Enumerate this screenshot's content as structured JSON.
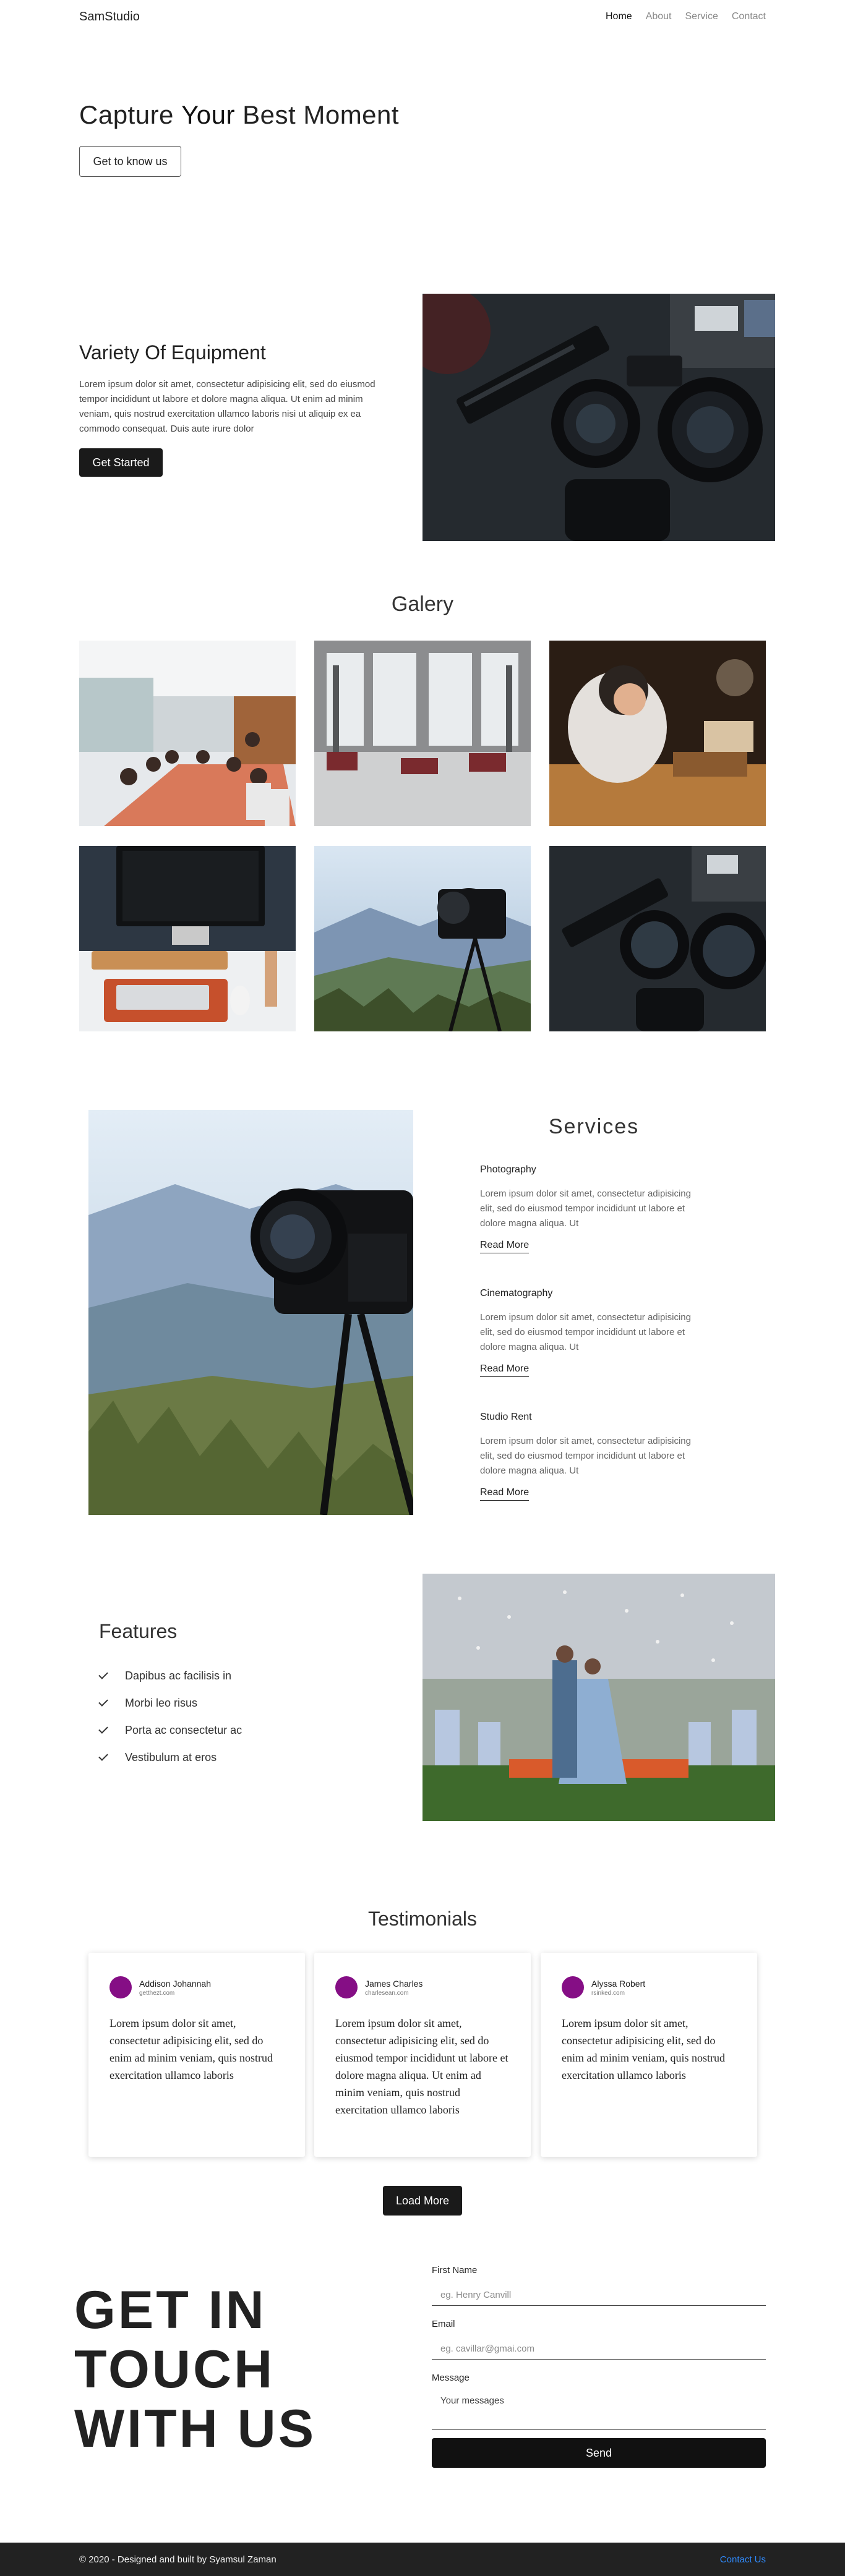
{
  "nav": {
    "brand": "SamStudio",
    "links": [
      {
        "label": "Home",
        "active": true
      },
      {
        "label": "About",
        "active": false
      },
      {
        "label": "Service",
        "active": false
      },
      {
        "label": "Contact",
        "active": false
      }
    ]
  },
  "hero": {
    "title_before": "Capture ",
    "title_bold": "Your",
    "title_after": " Best Moment",
    "button": "Get to know us"
  },
  "equipment": {
    "title": "Variety Of Equipment",
    "text": "Lorem ipsum dolor sit amet, consectetur adipisicing elit, sed do eiusmod tempor incididunt ut labore et dolore magna aliqua. Ut enim ad minim veniam, quis nostrud exercitation ullamco laboris nisi ut aliquip ex ea commodo consequat. Duis aute irure dolor",
    "button": "Get Started"
  },
  "gallery": {
    "title": "Galery"
  },
  "services": {
    "title": "Services",
    "items": [
      {
        "name": "Photography",
        "desc": "Lorem ipsum dolor sit amet, consectetur adipisicing elit, sed do eiusmod tempor incididunt ut labore et dolore magna aliqua. Ut",
        "link": "Read More"
      },
      {
        "name": "Cinematography",
        "desc": "Lorem ipsum dolor sit amet, consectetur adipisicing elit, sed do eiusmod tempor incididunt ut labore et dolore magna aliqua. Ut",
        "link": "Read More"
      },
      {
        "name": "Studio Rent",
        "desc": "Lorem ipsum dolor sit amet, consectetur adipisicing elit, sed do eiusmod tempor incididunt ut labore et dolore magna aliqua. Ut",
        "link": "Read More"
      }
    ]
  },
  "features": {
    "title": "Features",
    "items": [
      "Dapibus ac facilisis in",
      "Morbi leo risus",
      "Porta ac consectetur ac",
      "Vestibulum at eros"
    ]
  },
  "testimonials": {
    "title": "Testimonials",
    "cards": [
      {
        "name": "Addison Johannah",
        "email": "getthezt.com",
        "text": "Lorem ipsum dolor sit amet, consectetur adipisicing elit, sed do enim ad minim veniam, quis nostrud exercitation ullamco laboris"
      },
      {
        "name": "James Charles",
        "email": "charlesean.com",
        "text": "Lorem ipsum dolor sit amet, consectetur adipisicing elit, sed do eiusmod tempor incididunt ut labore et dolore magna aliqua. Ut enim ad minim veniam, quis nostrud exercitation ullamco laboris"
      },
      {
        "name": "Alyssa Robert",
        "email": "rsinked.com",
        "text": "Lorem ipsum dolor sit amet, consectetur adipisicing elit, sed do enim ad minim veniam, quis nostrud exercitation ullamco laboris"
      }
    ],
    "button": "Load More"
  },
  "contact": {
    "title_lines": [
      "GET IN",
      "TOUCH",
      "WITH US"
    ],
    "first_name_label": "First Name",
    "first_name_placeholder": "eg. Henry Canvill",
    "email_label": "Email",
    "email_placeholder": "eg. cavillar@gmai.com",
    "message_label": "Message",
    "message_placeholder": "Your messages",
    "button": "Send"
  },
  "footer": {
    "copyright": "© 2020 - Designed and built by Syamsul Zaman",
    "link": "Contact Us"
  },
  "colors": {
    "dark": "#1a1a1a",
    "avatar": "#850e85",
    "footer_bg": "#222222",
    "footer_link": "#2f8bff"
  }
}
